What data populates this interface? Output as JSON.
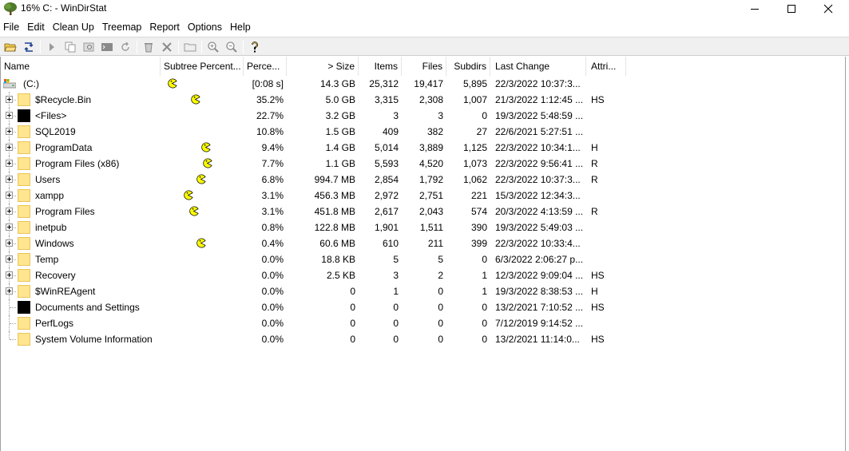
{
  "window": {
    "title": "16% C: - WinDirStat"
  },
  "menu": [
    "File",
    "Edit",
    "Clean Up",
    "Treemap",
    "Report",
    "Options",
    "Help"
  ],
  "columns": {
    "name": "Name",
    "subtree": "Subtree Percent...",
    "perc": "Perce...",
    "size": "> Size",
    "items": "Items",
    "files": "Files",
    "subdirs": "Subdirs",
    "last_change": "Last Change",
    "attr": "Attri..."
  },
  "root": {
    "name": "(C:)",
    "perc": "[0:08 s]",
    "size": "14.3 GB",
    "items": "25,312",
    "files": "19,417",
    "subdirs": "5,895",
    "last_change": "22/3/2022  10:37:3...",
    "attr": ""
  },
  "rows": [
    {
      "name": "$Recycle.Bin",
      "icon": "folder",
      "expander": true,
      "pac": true,
      "perc": "35.2%",
      "size": "5.0 GB",
      "items": "3,315",
      "files": "2,308",
      "subdirs": "1,007",
      "last_change": "21/3/2022  1:12:45 ...",
      "attr": "HS"
    },
    {
      "name": "<Files>",
      "icon": "black",
      "expander": true,
      "pac": false,
      "perc": "22.7%",
      "size": "3.2 GB",
      "items": "3",
      "files": "3",
      "subdirs": "0",
      "last_change": "19/3/2022  5:48:59 ...",
      "attr": ""
    },
    {
      "name": "SQL2019",
      "icon": "folder",
      "expander": true,
      "pac": false,
      "perc": "10.8%",
      "size": "1.5 GB",
      "items": "409",
      "files": "382",
      "subdirs": "27",
      "last_change": "22/6/2021  5:27:51 ...",
      "attr": ""
    },
    {
      "name": "ProgramData",
      "icon": "folder",
      "expander": true,
      "pac": true,
      "perc": "9.4%",
      "size": "1.4 GB",
      "items": "5,014",
      "files": "3,889",
      "subdirs": "1,125",
      "last_change": "22/3/2022  10:34:1...",
      "attr": "H"
    },
    {
      "name": "Program Files (x86)",
      "icon": "folder",
      "expander": true,
      "pac": true,
      "perc": "7.7%",
      "size": "1.1 GB",
      "items": "5,593",
      "files": "4,520",
      "subdirs": "1,073",
      "last_change": "22/3/2022  9:56:41 ...",
      "attr": "R"
    },
    {
      "name": "Users",
      "icon": "folder",
      "expander": true,
      "pac": true,
      "perc": "6.8%",
      "size": "994.7 MB",
      "items": "2,854",
      "files": "1,792",
      "subdirs": "1,062",
      "last_change": "22/3/2022  10:37:3...",
      "attr": "R"
    },
    {
      "name": "xampp",
      "icon": "folder",
      "expander": true,
      "pac": true,
      "perc": "3.1%",
      "size": "456.3 MB",
      "items": "2,972",
      "files": "2,751",
      "subdirs": "221",
      "last_change": "15/3/2022  12:34:3...",
      "attr": ""
    },
    {
      "name": "Program Files",
      "icon": "folder",
      "expander": true,
      "pac": true,
      "perc": "3.1%",
      "size": "451.8 MB",
      "items": "2,617",
      "files": "2,043",
      "subdirs": "574",
      "last_change": "20/3/2022  4:13:59 ...",
      "attr": "R"
    },
    {
      "name": "inetpub",
      "icon": "folder",
      "expander": true,
      "pac": false,
      "perc": "0.8%",
      "size": "122.8 MB",
      "items": "1,901",
      "files": "1,511",
      "subdirs": "390",
      "last_change": "19/3/2022  5:49:03 ...",
      "attr": ""
    },
    {
      "name": "Windows",
      "icon": "folder",
      "expander": true,
      "pac": true,
      "perc": "0.4%",
      "size": "60.6 MB",
      "items": "610",
      "files": "211",
      "subdirs": "399",
      "last_change": "22/3/2022  10:33:4...",
      "attr": ""
    },
    {
      "name": "Temp",
      "icon": "folder",
      "expander": true,
      "pac": false,
      "perc": "0.0%",
      "size": "18.8 KB",
      "items": "5",
      "files": "5",
      "subdirs": "0",
      "last_change": "6/3/2022  2:06:27 p...",
      "attr": ""
    },
    {
      "name": "Recovery",
      "icon": "folder",
      "expander": true,
      "pac": false,
      "perc": "0.0%",
      "size": "2.5 KB",
      "items": "3",
      "files": "2",
      "subdirs": "1",
      "last_change": "12/3/2022  9:09:04 ...",
      "attr": "HS"
    },
    {
      "name": "$WinREAgent",
      "icon": "folder",
      "expander": true,
      "pac": false,
      "perc": "0.0%",
      "size": "0",
      "items": "1",
      "files": "0",
      "subdirs": "1",
      "last_change": "19/3/2022  8:38:53 ...",
      "attr": "H"
    },
    {
      "name": "Documents and Settings",
      "icon": "black",
      "expander": false,
      "pac": false,
      "perc": "0.0%",
      "size": "0",
      "items": "0",
      "files": "0",
      "subdirs": "0",
      "last_change": "13/2/2021  7:10:52 ...",
      "attr": "HS"
    },
    {
      "name": "PerfLogs",
      "icon": "folder",
      "expander": false,
      "pac": false,
      "perc": "0.0%",
      "size": "0",
      "items": "0",
      "files": "0",
      "subdirs": "0",
      "last_change": "7/12/2019  9:14:52 ...",
      "attr": ""
    },
    {
      "name": "System Volume Information",
      "icon": "folder",
      "expander": false,
      "pac": false,
      "perc": "0.0%",
      "size": "0",
      "items": "0",
      "files": "0",
      "subdirs": "0",
      "last_change": "13/2/2021  11:14:0...",
      "attr": "HS"
    }
  ],
  "colors": {
    "folder": "#ffe58f",
    "pacman": "#ffff00",
    "pacman_outline": "#000000"
  }
}
